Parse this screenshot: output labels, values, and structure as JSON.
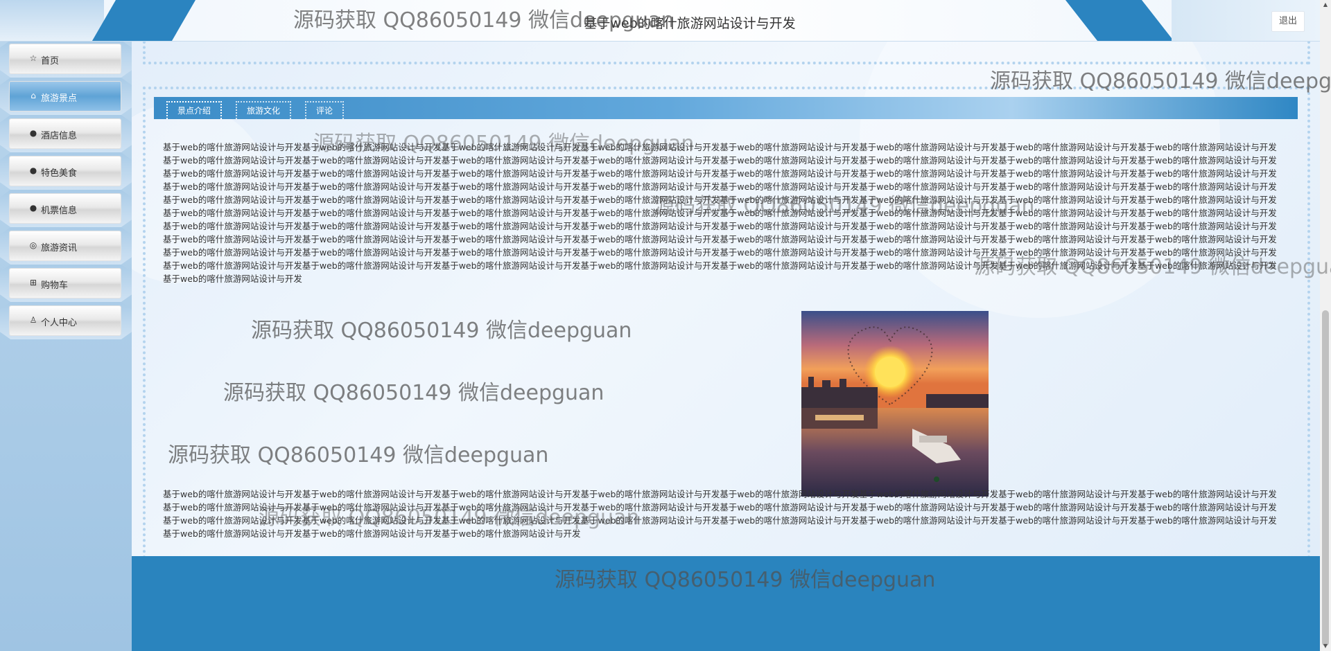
{
  "header": {
    "title": "基于web的喀什旅游网站设计与开发",
    "logout_label": "退出"
  },
  "sidebar": {
    "items": [
      {
        "label": "首页",
        "icon": "star-icon",
        "glyph": "☆",
        "active": false
      },
      {
        "label": "旅游景点",
        "icon": "home-icon",
        "glyph": "⌂",
        "active": true
      },
      {
        "label": "酒店信息",
        "icon": "info-icon",
        "glyph": "●",
        "active": false
      },
      {
        "label": "特色美食",
        "icon": "question-icon",
        "glyph": "●",
        "active": false
      },
      {
        "label": "机票信息",
        "icon": "info-icon",
        "glyph": "●",
        "active": false
      },
      {
        "label": "旅游资讯",
        "icon": "globe-icon",
        "glyph": "◎",
        "active": false
      },
      {
        "label": "购物车",
        "icon": "cart-icon",
        "glyph": "⊞",
        "active": false
      },
      {
        "label": "个人中心",
        "icon": "user-icon",
        "glyph": "♙",
        "active": false
      }
    ]
  },
  "tabs": [
    {
      "label": "景点介绍",
      "active": true
    },
    {
      "label": "旅游文化",
      "active": false
    },
    {
      "label": "评论",
      "active": false
    }
  ],
  "content": {
    "repeat_phrase": "基于web的喀什旅游网站设计与开发",
    "upper_paragraph_repeats": 81,
    "lower_paragraph_repeats": 27
  },
  "watermark_text": "源码获取 QQ86050149 微信deepguan",
  "colors": {
    "accent": "#2b84c0",
    "footer": "#2a84be",
    "active_menu": "#5fa3d6"
  }
}
